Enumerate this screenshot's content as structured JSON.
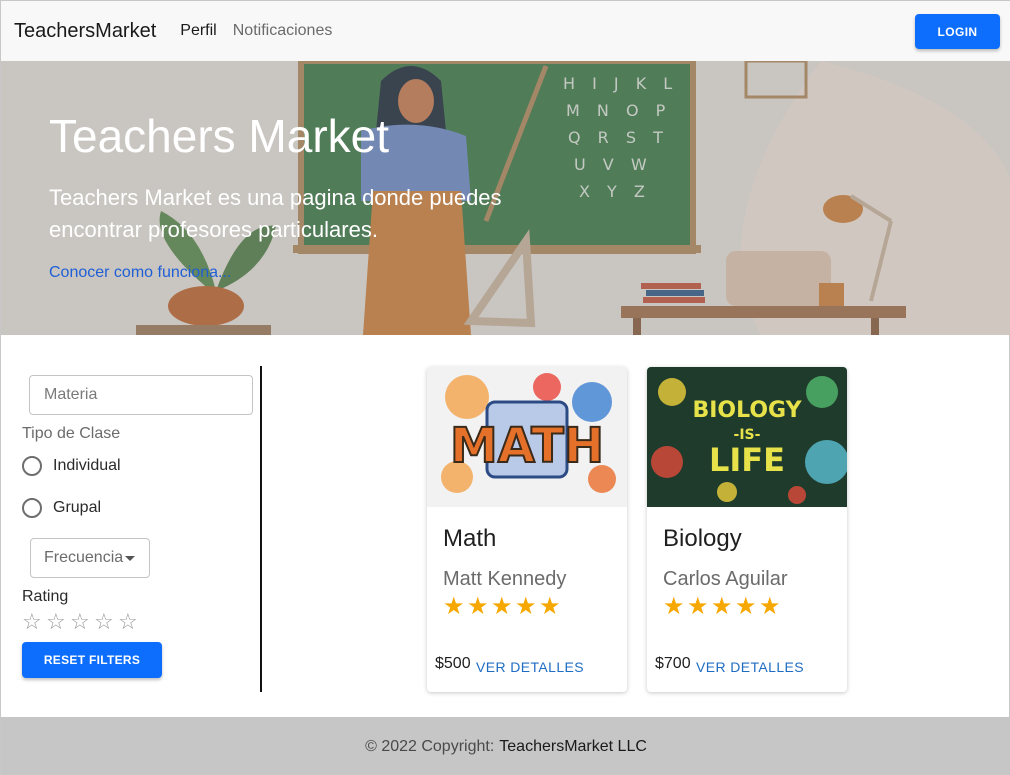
{
  "navbar": {
    "brand": "TeachersMarket",
    "links": [
      "Perfil",
      "Notificaciones"
    ],
    "login_label": "LOGIN"
  },
  "hero": {
    "title": "Teachers Market",
    "description": "Teachers Market es una pagina donde puedes encontrar profesores particulares.",
    "link_text": "Conocer como funciona...",
    "chalkboard_letters": [
      "H I J K L",
      "M N O P",
      "Q R S T",
      "U V W",
      "X Y Z"
    ]
  },
  "filters": {
    "materia_placeholder": "Materia",
    "tipo_label": "Tipo de Clase",
    "options": [
      "Individual",
      "Grupal"
    ],
    "frecuencia_label": "Frecuencia",
    "rating_label": "Rating",
    "rating_value": 0,
    "reset_label": "RESET FILTERS"
  },
  "cards": [
    {
      "subject": "Math",
      "teacher": "Matt Kennedy",
      "rating": 5,
      "price": "$500",
      "details_label": "VER DETALLES",
      "image_text": [
        "MATH"
      ]
    },
    {
      "subject": "Biology",
      "teacher": "Carlos Aguilar",
      "rating": 5,
      "price": "$700",
      "details_label": "VER DETALLES",
      "image_text": [
        "BIOLOGY",
        "-IS-",
        "LIFE"
      ]
    }
  ],
  "footer": {
    "copyright": "© 2022 Copyright:",
    "company": "TeachersMarket LLC"
  },
  "colors": {
    "primary": "#0d6efd",
    "star": "#f6a800",
    "link": "#1f6dc2",
    "footer_bg": "#c6c6c6"
  }
}
